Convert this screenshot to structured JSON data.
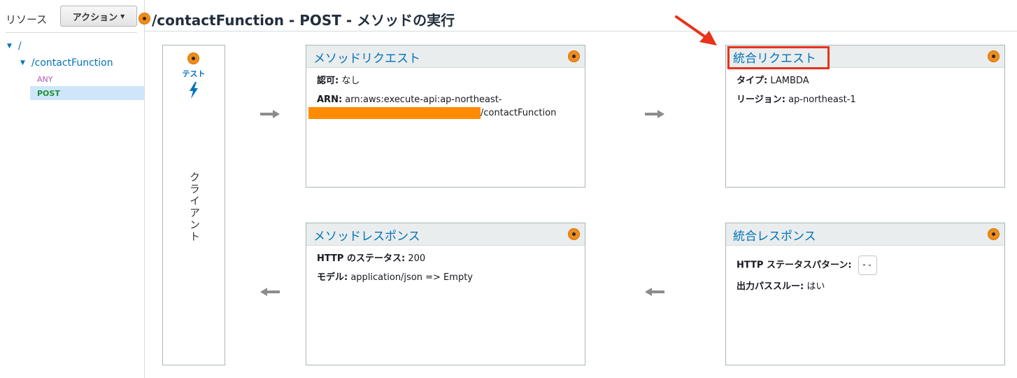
{
  "sidebar": {
    "resources_label": "リソース",
    "actions_button": "アクション",
    "tree": [
      {
        "label": "/"
      },
      {
        "label": "/contactFunction"
      }
    ],
    "methods": [
      {
        "label": "ANY"
      },
      {
        "label": "POST"
      }
    ]
  },
  "header": {
    "title": "/contactFunction - POST - メソッドの実行"
  },
  "client": {
    "test_label": "テスト",
    "label": "クライアント"
  },
  "method_request": {
    "title": "メソッドリクエスト",
    "auth_key": "認可:",
    "auth_value": "なし",
    "arn_key": "ARN:",
    "arn_value": "arn:aws:execute-api:ap-northeast-",
    "arn_tail": "/contactFunction"
  },
  "integration_request": {
    "title": "統合リクエスト",
    "type_key": "タイプ:",
    "type_value": "LAMBDA",
    "region_key": "リージョン:",
    "region_value": "ap-northeast-1"
  },
  "method_response": {
    "title": "メソッドレスポンス",
    "status_key": "HTTP のステータス:",
    "status_value": "200",
    "model_key": "モデル:",
    "model_value": "application/json => Empty"
  },
  "integration_response": {
    "title": "統合レスポンス",
    "pattern_key": "HTTP ステータスパターン:",
    "pattern_value": "-",
    "passthrough_key": "出力パススルー:",
    "passthrough_value": "はい"
  },
  "colors": {
    "accent_orange": "#f08c1a",
    "link_blue": "#0073bb",
    "highlight_red": "#e8321b",
    "redaction": "#ff8c00"
  }
}
